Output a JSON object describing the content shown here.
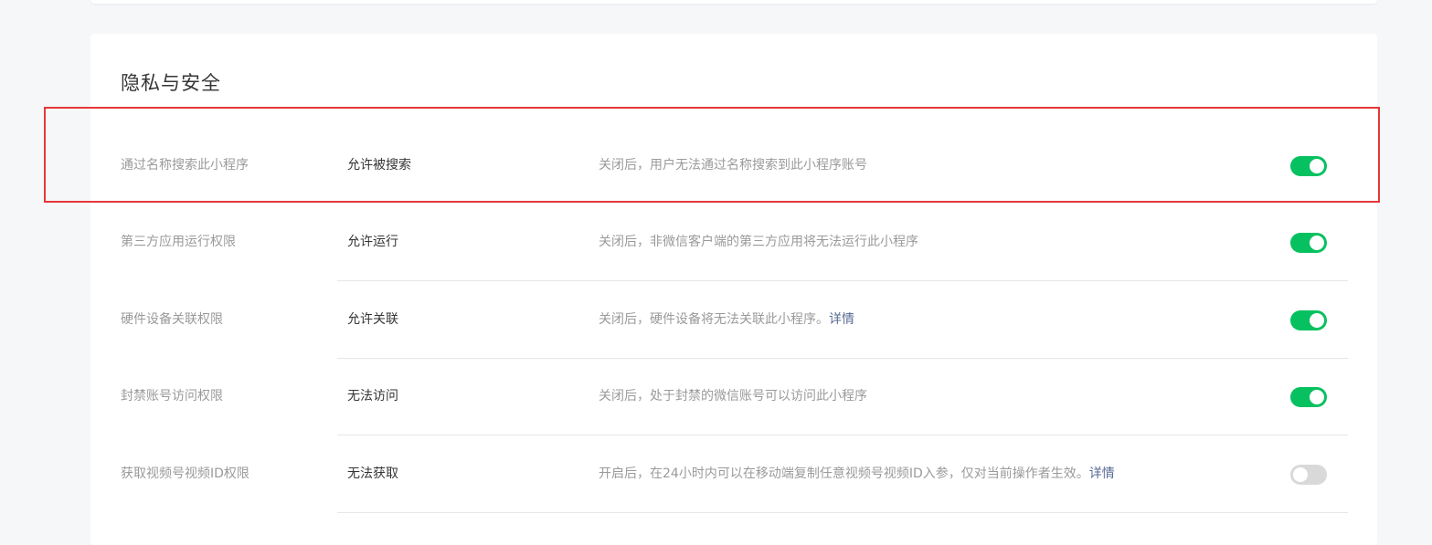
{
  "section": {
    "title": "隐私与安全"
  },
  "settings": [
    {
      "label": "通过名称搜索此小程序",
      "value": "允许被搜索",
      "description": "关闭后，用户无法通过名称搜索到此小程序账号",
      "link": "",
      "enabled": true
    },
    {
      "label": "第三方应用运行权限",
      "value": "允许运行",
      "description": "关闭后，非微信客户端的第三方应用将无法运行此小程序",
      "link": "",
      "enabled": true
    },
    {
      "label": "硬件设备关联权限",
      "value": "允许关联",
      "description": "关闭后，硬件设备将无法关联此小程序。",
      "link": "详情",
      "enabled": true
    },
    {
      "label": "封禁账号访问权限",
      "value": "无法访问",
      "description": "关闭后，处于封禁的微信账号可以访问此小程序",
      "link": "",
      "enabled": true
    },
    {
      "label": "获取视频号视频ID权限",
      "value": "无法获取",
      "description": "开启后，在24小时内可以在移动端复制任意视频号视频ID入参，仅对当前操作者生效。",
      "link": "详情",
      "enabled": false
    }
  ],
  "colors": {
    "toggle_on": "#07c160",
    "toggle_off": "#d9d9d9",
    "link": "#576b95",
    "highlight_border": "#e5373a"
  }
}
